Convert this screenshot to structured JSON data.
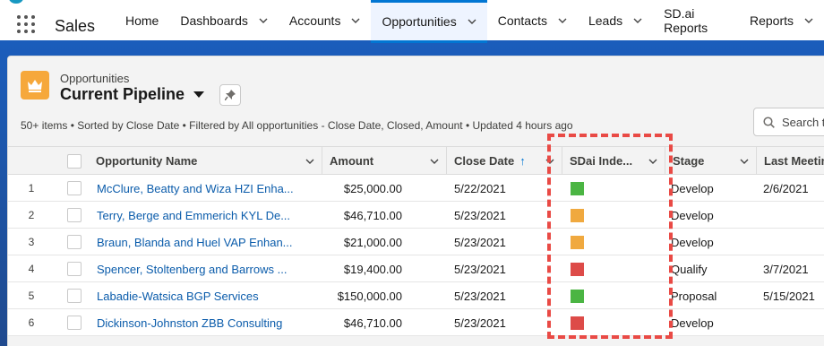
{
  "app": {
    "name": "Sales"
  },
  "nav": {
    "tabs": [
      {
        "label": "Home",
        "dropdown": false,
        "active": false
      },
      {
        "label": "Dashboards",
        "dropdown": true,
        "active": false
      },
      {
        "label": "Accounts",
        "dropdown": true,
        "active": false
      },
      {
        "label": "Opportunities",
        "dropdown": true,
        "active": true
      },
      {
        "label": "Contacts",
        "dropdown": true,
        "active": false
      },
      {
        "label": "Leads",
        "dropdown": true,
        "active": false
      },
      {
        "label": "SD.ai Reports",
        "dropdown": false,
        "active": false
      },
      {
        "label": "Reports",
        "dropdown": true,
        "active": false
      }
    ]
  },
  "list_view": {
    "object_label": "Opportunities",
    "title": "Current Pipeline",
    "meta": "50+ items • Sorted by Close Date • Filtered by All opportunities - Close Date, Closed, Amount • Updated 4 hours ago",
    "search_placeholder": "Search t"
  },
  "table": {
    "columns": [
      {
        "label": "Opportunity Name"
      },
      {
        "label": "Amount"
      },
      {
        "label": "Close Date"
      },
      {
        "label": "SDai Inde..."
      },
      {
        "label": "Stage"
      },
      {
        "label": "Last Meetin"
      }
    ],
    "rows": [
      {
        "num": "1",
        "name": "McClure, Beatty and Wiza HZI Enha...",
        "amount": "$25,000.00",
        "close_date": "5/22/2021",
        "sdai": "green",
        "stage": "Develop",
        "last_meeting": "2/6/2021"
      },
      {
        "num": "2",
        "name": "Terry, Berge and Emmerich KYL De...",
        "amount": "$46,710.00",
        "close_date": "5/23/2021",
        "sdai": "orange",
        "stage": "Develop",
        "last_meeting": ""
      },
      {
        "num": "3",
        "name": "Braun, Blanda and Huel VAP Enhan...",
        "amount": "$21,000.00",
        "close_date": "5/23/2021",
        "sdai": "orange",
        "stage": "Develop",
        "last_meeting": ""
      },
      {
        "num": "4",
        "name": "Spencer, Stoltenberg and Barrows ...",
        "amount": "$19,400.00",
        "close_date": "5/23/2021",
        "sdai": "red",
        "stage": "Qualify",
        "last_meeting": "3/7/2021"
      },
      {
        "num": "5",
        "name": "Labadie-Watsica BGP Services",
        "amount": "$150,000.00",
        "close_date": "5/23/2021",
        "sdai": "green",
        "stage": "Proposal",
        "last_meeting": "5/15/2021"
      },
      {
        "num": "6",
        "name": "Dickinson-Johnston ZBB Consulting",
        "amount": "$46,710.00",
        "close_date": "5/23/2021",
        "sdai": "red",
        "stage": "Develop",
        "last_meeting": ""
      }
    ]
  },
  "colors": {
    "green": "#4bb543",
    "orange": "#f0a93f",
    "red": "#dd4b48",
    "link": "#0b5cab",
    "accent": "#0176d3",
    "highlight": "#e94a45"
  }
}
